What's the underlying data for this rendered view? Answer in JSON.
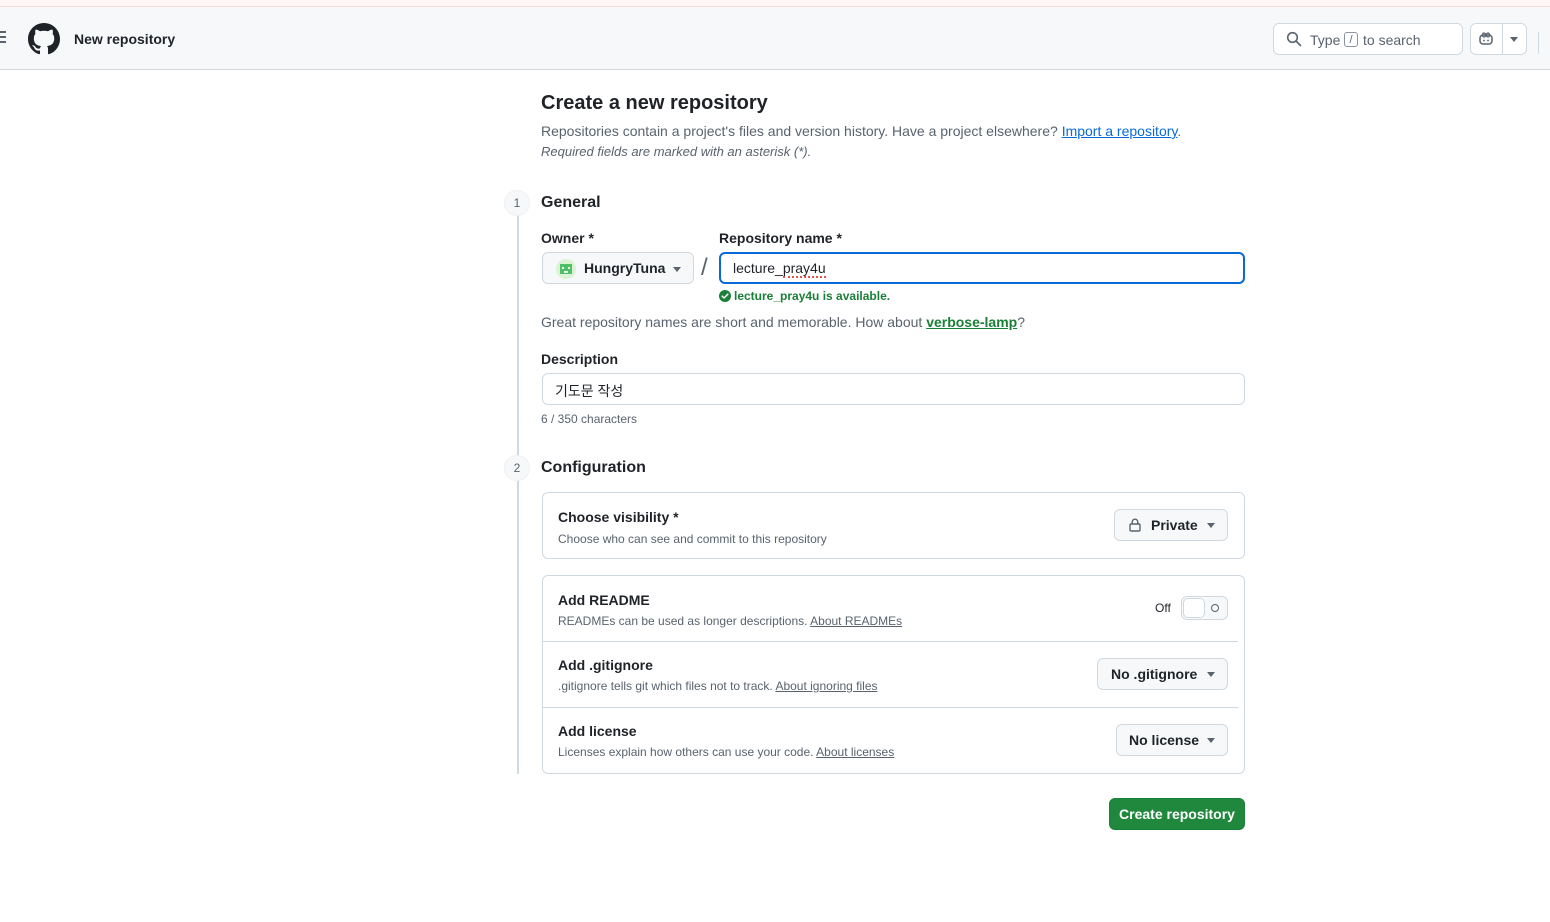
{
  "header": {
    "context_title": "New repository",
    "search_prefix": "Type",
    "search_key": "/",
    "search_suffix": "to search"
  },
  "page": {
    "title": "Create a new repository",
    "lead_text": "Repositories contain a project's files and version history. Have a project elsewhere?",
    "import_link": "Import a repository",
    "lead_end": ".",
    "required_note": "Required fields are marked with an asterisk (*)."
  },
  "general": {
    "step": "1",
    "title": "General",
    "owner_label": "Owner *",
    "owner_value": "HungryTuna",
    "separator": "/",
    "name_label": "Repository name *",
    "name_value_a": "lecture_",
    "name_value_b": "pray4u",
    "availability": "lecture_pray4u is available.",
    "hint_text": "Great repository names are short and memorable. How about",
    "hint_suggestion": "verbose-lamp",
    "hint_end": "?",
    "description_label": "Description",
    "description_value": "기도문 작성",
    "char_count": "6 / 350 characters"
  },
  "configuration": {
    "step": "2",
    "title": "Configuration",
    "visibility": {
      "title": "Choose visibility *",
      "desc": "Choose who can see and commit to this repository",
      "value": "Private"
    },
    "readme": {
      "title": "Add README",
      "desc": "READMEs can be used as longer descriptions.",
      "link": "About READMEs",
      "toggle_label": "Off"
    },
    "gitignore": {
      "title": "Add .gitignore",
      "desc": ".gitignore tells git which files not to track.",
      "link": "About ignoring files",
      "value": "No .gitignore"
    },
    "license": {
      "title": "Add license",
      "desc": "Licenses explain how others can use your code.",
      "link": "About licenses",
      "value": "No license"
    }
  },
  "actions": {
    "create_label": "Create repository"
  },
  "colors": {
    "primary_green": "#1f883d",
    "link_blue": "#0969da",
    "focus_blue": "#0969da",
    "success_green": "#1a7f37"
  }
}
